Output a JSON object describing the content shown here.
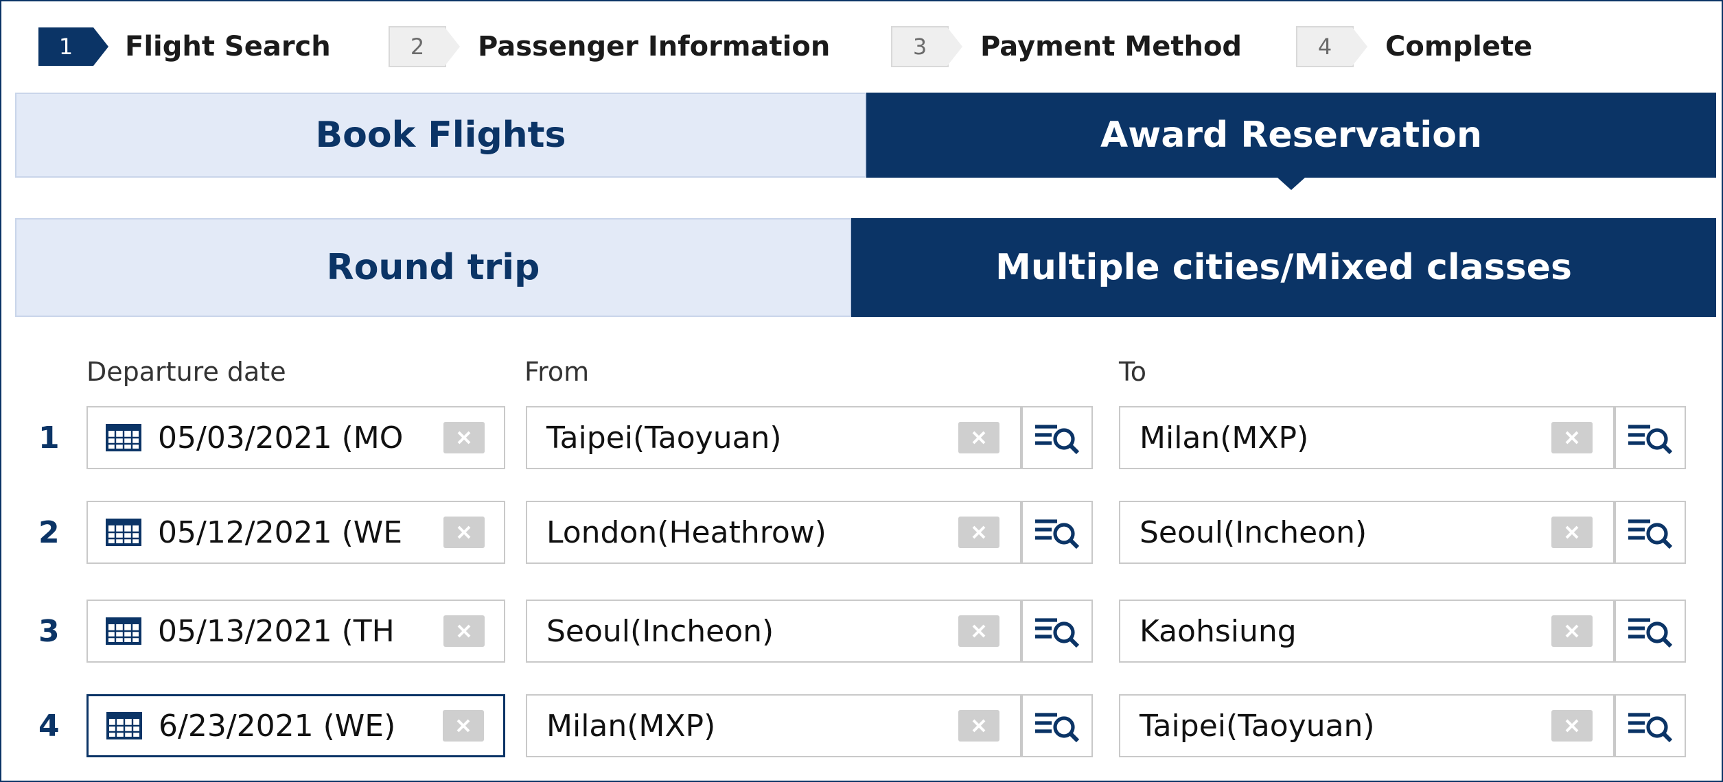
{
  "steps": [
    {
      "num": "1",
      "label": "Flight Search"
    },
    {
      "num": "2",
      "label": "Passenger Information"
    },
    {
      "num": "3",
      "label": "Payment Method"
    },
    {
      "num": "4",
      "label": "Complete"
    }
  ],
  "booking_tabs": {
    "book_flights": "Book Flights",
    "award_reservation": "Award Reservation"
  },
  "trip_tabs": {
    "round_trip": "Round trip",
    "multi_city": "Multiple cities/Mixed classes"
  },
  "form": {
    "headers": {
      "departure": "Departure date",
      "from": "From",
      "to": "To"
    },
    "rows": [
      {
        "num": "1",
        "date": "05/03/2021 (MO",
        "from": "Taipei(Taoyuan)",
        "to": "Milan(MXP)"
      },
      {
        "num": "2",
        "date": "05/12/2021 (WE",
        "from": "London(Heathrow)",
        "to": "Seoul(Incheon)"
      },
      {
        "num": "3",
        "date": "05/13/2021 (TH",
        "from": "Seoul(Incheon)",
        "to": "Kaohsiung"
      },
      {
        "num": "4",
        "date": "6/23/2021 (WE)",
        "from": "Milan(MXP)",
        "to": "Taipei(Taoyuan)"
      }
    ]
  },
  "icons": {
    "calendar": "calendar-icon",
    "clear": "close-icon",
    "lookup": "list-search-icon"
  },
  "colors": {
    "brand_navy": "#0b3466",
    "tab_inactive_bg": "#e3eaf7",
    "clear_button": "#cfcfcf"
  }
}
